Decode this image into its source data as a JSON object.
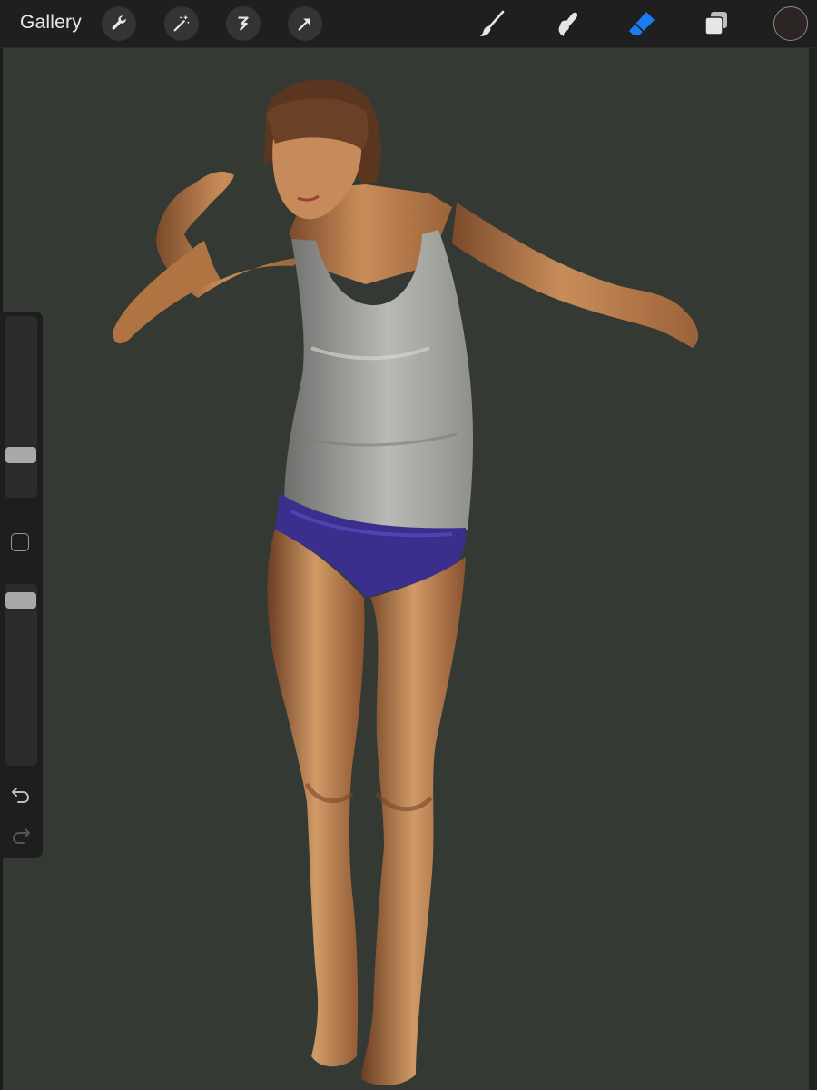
{
  "toolbar": {
    "gallery_label": "Gallery",
    "left_tools": [
      "wrench-icon",
      "magic-wand-icon",
      "selection-icon",
      "transform-arrow-icon"
    ],
    "right_tools": [
      "brush-icon",
      "smudge-icon",
      "eraser-icon",
      "layers-icon"
    ],
    "active_tool": "eraser",
    "accent_color": "#1a7cf0",
    "current_color": "#2b2623"
  },
  "sidebar": {
    "brush_size_level": 0.21,
    "brush_opacity_level": 0.05,
    "icons": [
      "modify-square-icon",
      "undo-icon",
      "redo-icon"
    ]
  },
  "canvas": {
    "background_color": "#343a33"
  }
}
